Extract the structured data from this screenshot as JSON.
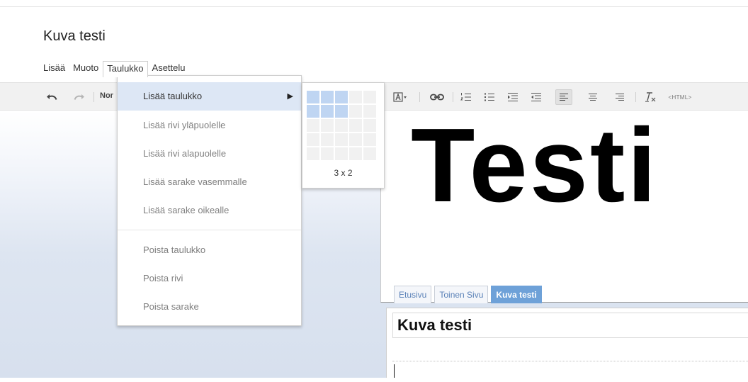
{
  "page": {
    "title": "Kuva testi"
  },
  "menubar": {
    "items": [
      {
        "label": "Lisää",
        "active": false
      },
      {
        "label": "Muoto",
        "active": false
      },
      {
        "label": "Taulukko",
        "active": true
      },
      {
        "label": "Asettelu",
        "active": false
      }
    ]
  },
  "toolbar": {
    "format_label": "Nor",
    "html_label": "<HTML>",
    "icons": [
      "undo-icon",
      "redo-icon",
      "font-color-icon",
      "link-icon",
      "numbered-list-icon",
      "bullet-list-icon",
      "indent-icon",
      "outdent-icon",
      "align-left-icon",
      "align-center-icon",
      "align-right-icon",
      "clear-formatting-icon"
    ]
  },
  "table_menu": {
    "items": [
      {
        "label": "Lisää taulukko",
        "highlighted": true,
        "submenu": true
      },
      {
        "label": "Lisää rivi yläpuolelle",
        "highlighted": false
      },
      {
        "label": "Lisää rivi alapuolelle",
        "highlighted": false
      },
      {
        "label": "Lisää sarake vasemmalle",
        "highlighted": false
      },
      {
        "label": "Lisää sarake oikealle",
        "highlighted": false
      },
      {
        "label": "Poista taulukko",
        "highlighted": false
      },
      {
        "label": "Poista rivi",
        "highlighted": false
      },
      {
        "label": "Poista sarake",
        "highlighted": false
      }
    ],
    "submenu_arrow": "▶"
  },
  "table_picker": {
    "columns": 5,
    "rows": 5,
    "selected_columns": 3,
    "selected_rows": 2,
    "size_label": "3 x 2"
  },
  "preview": {
    "text": "Testi"
  },
  "page_tabs": [
    {
      "label": "Etusivu",
      "active": false
    },
    {
      "label": "Toinen Sivu",
      "active": false
    },
    {
      "label": "Kuva testi",
      "active": true
    }
  ],
  "editor": {
    "title_value": "Kuva testi"
  },
  "colors": {
    "menu_highlight": "#dde7f5",
    "picker_selected": "#bfd5f2",
    "active_tab": "#6ea1d8",
    "tab_text": "#5b82b8"
  }
}
